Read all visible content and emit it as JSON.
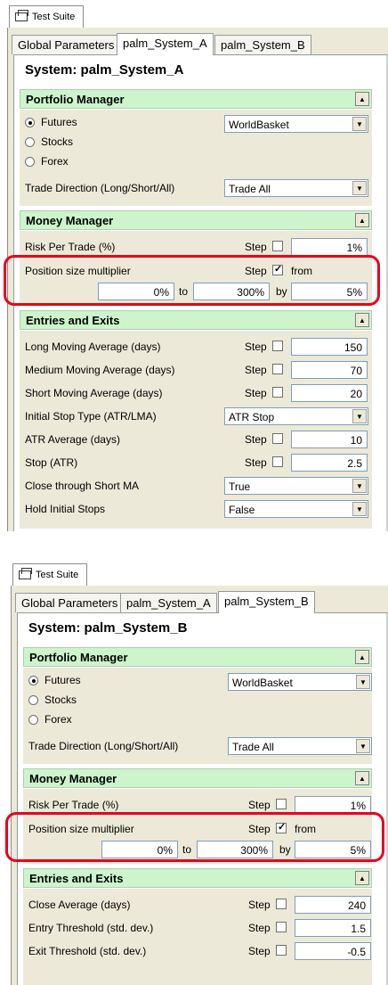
{
  "suite_tab": "Test Suite",
  "tabs": [
    "Global Parameters",
    "palm_System_A",
    "palm_System_B"
  ],
  "portfolio": {
    "title": "Portfolio Manager",
    "radios": [
      "Futures",
      "Stocks",
      "Forex"
    ],
    "selected_radio": "Futures",
    "dropdown": "WorldBasket",
    "trade_direction_label": "Trade Direction (Long/Short/All)",
    "trade_direction_value": "Trade All"
  },
  "money": {
    "title": "Money Manager",
    "risk_label": "Risk Per Trade (%)",
    "risk_value": "1%",
    "pos_label": "Position size multiplier",
    "from_label": "from",
    "from_value": "0%",
    "to_label": "to",
    "to_value": "300%",
    "by_label": "by",
    "by_value": "5%"
  },
  "step_label": "Step",
  "entries_title": "Entries and Exits",
  "pane_a": {
    "system_title": "System: palm_System_A",
    "active_tab": "palm_System_A",
    "entries": {
      "long_label": "Long Moving Average (days)",
      "long_value": "150",
      "medium_label": "Medium Moving Average (days)",
      "medium_value": "70",
      "short_label": "Short Moving Average (days)",
      "short_value": "20",
      "initstop_label": "Initial Stop Type (ATR/LMA)",
      "initstop_value": "ATR Stop",
      "atr_label": "ATR Average (days)",
      "atr_value": "10",
      "stop_label": "Stop (ATR)",
      "stop_value": "2.5",
      "close_label": "Close through Short MA",
      "close_value": "True",
      "hold_label": "Hold Initial Stops",
      "hold_value": "False"
    }
  },
  "pane_b": {
    "system_title": "System: palm_System_B",
    "active_tab": "palm_System_B",
    "entries": {
      "closeavg_label": "Close Average (days)",
      "closeavg_value": "240",
      "entry_label": "Entry Threshold (std. dev.)",
      "entry_value": "1.5",
      "exit_label": "Exit Threshold (std. dev.)",
      "exit_value": "-0.5"
    }
  },
  "colors": {
    "section_header": "#ccf5cc",
    "panel_bg": "#ece9d8",
    "highlight": "#e8001c"
  }
}
